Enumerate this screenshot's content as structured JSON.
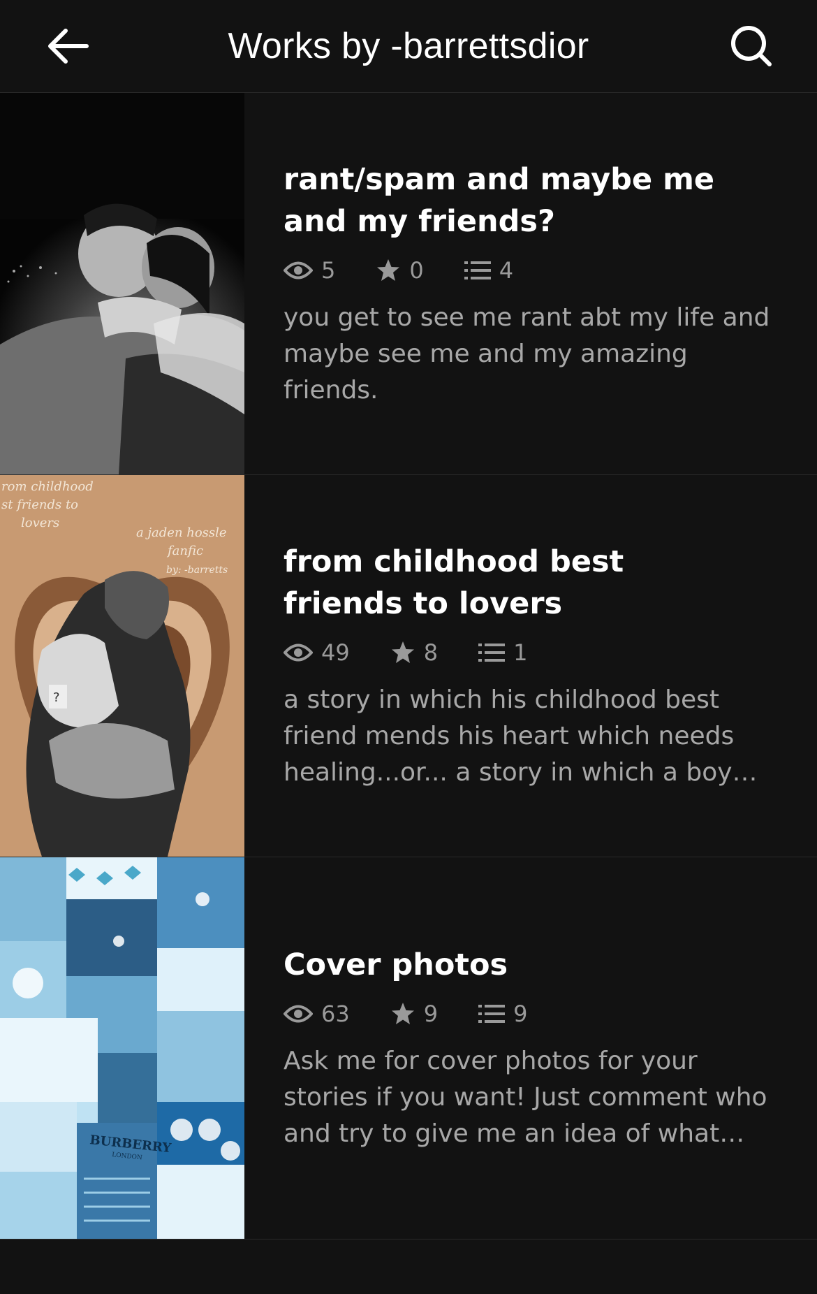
{
  "header": {
    "title": "Works by -barrettsdior",
    "back_icon": "arrow-left-icon",
    "search_icon": "search-icon"
  },
  "stories": [
    {
      "title": "rant/spam and maybe me and my friends?",
      "reads": "5",
      "votes": "0",
      "parts": "4",
      "description": "you get to see me rant abt my life and maybe see me and my amazing friends."
    },
    {
      "title": "from childhood best friends to lovers",
      "reads": "49",
      "votes": "8",
      "parts": "1",
      "description": "a story in which his childhood best friend mends his heart which needs healing...or... a story in which a boy fo…",
      "cover_text": {
        "line1": "rom childhood",
        "line2": "st friends to",
        "line3": "lovers",
        "line4": "a jaden hossle",
        "line5": "fanfic",
        "line6": "by: -barretts"
      }
    },
    {
      "title": "Cover photos",
      "reads": "63",
      "votes": "9",
      "parts": "9",
      "description": "Ask me for cover photos for your stories if you want! Just comment who and try to give me an idea of what style you w…",
      "cover_text": {
        "brand": "BURBERRY",
        "brand_sub": "LONDON"
      }
    }
  ],
  "colors": {
    "background": "#121212",
    "title_text": "#ffffff",
    "meta_text": "#9a9a9a",
    "description_text": "#a8a8a8",
    "divider": "#2a2a2a"
  }
}
